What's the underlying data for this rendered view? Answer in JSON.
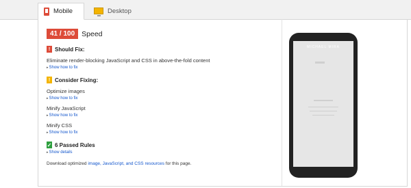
{
  "tabs": [
    {
      "label": "Mobile",
      "icon": "phone-icon",
      "active": true
    },
    {
      "label": "Desktop",
      "icon": "desktop-icon",
      "active": false
    }
  ],
  "score": {
    "value": "41 / 100",
    "label": "Speed",
    "color": "#dd4b39"
  },
  "should_fix": {
    "title": "Should Fix:",
    "items": [
      {
        "text": "Eliminate render-blocking JavaScript and CSS in above-the-fold content",
        "link": "Show how to fix"
      }
    ]
  },
  "consider_fixing": {
    "title": "Consider Fixing:",
    "items": [
      {
        "text": "Optimize images",
        "link": "Show how to fix"
      },
      {
        "text": "Minify JavaScript",
        "link": "Show how to fix"
      },
      {
        "text": "Minify CSS",
        "link": "Show how to fix"
      }
    ]
  },
  "passed": {
    "title": "6 Passed Rules",
    "link": "Show details"
  },
  "download": {
    "prefix": "Download optimized ",
    "link1": "image, JavaScript, and CSS resources",
    "suffix": " for this page."
  },
  "preview": {
    "site_title": "MICHAEL MIRA"
  }
}
